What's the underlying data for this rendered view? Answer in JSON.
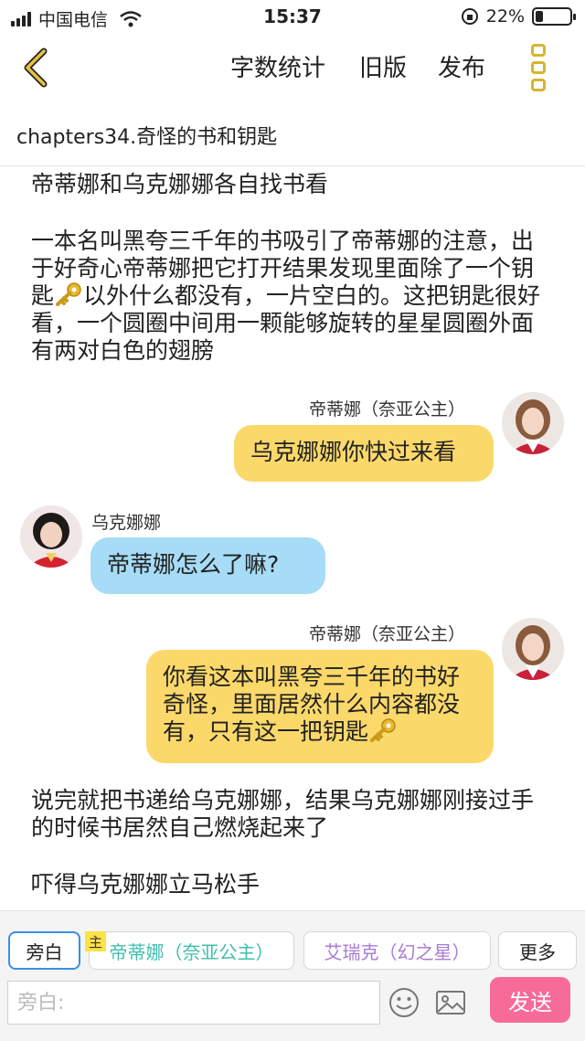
{
  "status": {
    "carrier": "中国电信",
    "time": "15:37",
    "battery": "22%",
    "battery_level": 0.22
  },
  "nav": {
    "word_count": "字数统计",
    "old_version": "旧版",
    "publish": "发布",
    "icons": [
      "back-chevron-icon",
      "more-menu-icon"
    ]
  },
  "chapter_title": "chapters34.奇怪的书和钥匙",
  "content": {
    "narration1": "帝蒂娜和乌克娜娜各自找书看",
    "narration2a": "一本名叫黑夸三千年的书吸引了帝蒂娜的注意，出于好奇心帝蒂娜把它打开结果发现里面除了一个钥匙",
    "narration2b": "以外什么都没有，一片空白的。这把钥匙很好看，一个圆圈中间用一颗能够旋转的星星圆圈外面有两对白色的翅膀",
    "msg1_name": "帝蒂娜（奈亚公主）",
    "msg1_text": "乌克娜娜你快过来看",
    "msg2_name": "乌克娜娜",
    "msg2_text": "帝蒂娜怎么了嘛?",
    "msg3_name": "帝蒂娜（奈亚公主）",
    "msg3_text": "你看这本叫黑夸三千年的书好奇怪，里面居然什么内容都没有，只有这一把钥匙",
    "narration3": "说完就把书递给乌克娜娜，结果乌克娜娜刚接过手的时候书居然自己燃烧起来了",
    "narration4": "吓得乌克娜娜立马松手"
  },
  "composer": {
    "narrator": "旁白",
    "main_badge": "主",
    "role1": "帝蒂娜（奈亚公主）",
    "role2": "艾瑞克（幻之星）",
    "more": "更多",
    "placeholder": "旁白:",
    "send": "发送"
  },
  "colors": {
    "accent_yellow": "#fbd86a",
    "accent_blue": "#a6dcf6",
    "send_pink": "#f76b99",
    "role1": "#3fbfae",
    "role2": "#a77bd6",
    "nav_icon": "#d8b42a"
  }
}
